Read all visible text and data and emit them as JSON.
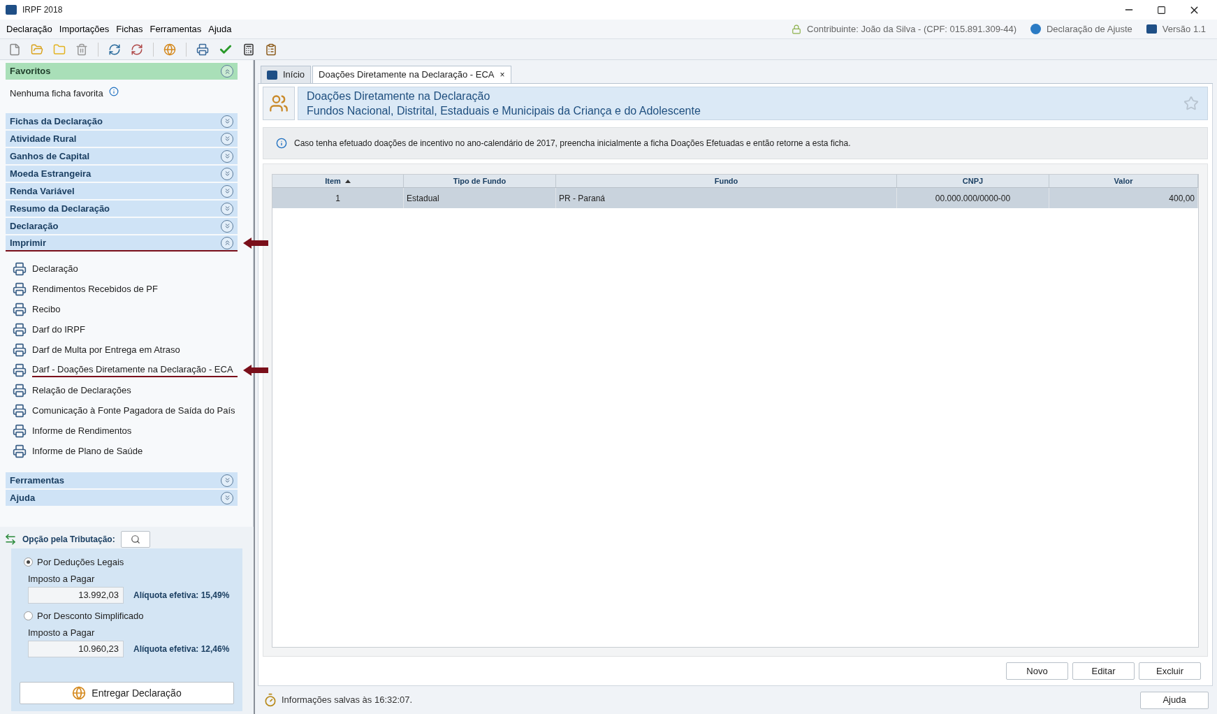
{
  "window": {
    "title": "IRPF 2018"
  },
  "menu": [
    {
      "label": "Declaração"
    },
    {
      "label": "Importações"
    },
    {
      "label": "Fichas"
    },
    {
      "label": "Ferramentas"
    },
    {
      "label": "Ajuda"
    }
  ],
  "header_info": {
    "contributor": "Contribuinte: João da Silva - (CPF: 015.891.309-44)",
    "declaration_type": "Declaração de Ajuste",
    "version": "Versão 1.1"
  },
  "favorites": {
    "title": "Favoritos",
    "expanded": true,
    "empty_text": "Nenhuma ficha favorita"
  },
  "sections": [
    {
      "title": "Fichas da Declaração",
      "expanded": false,
      "highlighted": false
    },
    {
      "title": "Atividade Rural",
      "expanded": false,
      "highlighted": false
    },
    {
      "title": "Ganhos de Capital",
      "expanded": false,
      "highlighted": false
    },
    {
      "title": "Moeda Estrangeira",
      "expanded": false,
      "highlighted": false
    },
    {
      "title": "Renda Variável",
      "expanded": false,
      "highlighted": false
    },
    {
      "title": "Resumo da Declaração",
      "expanded": false,
      "highlighted": false
    },
    {
      "title": "Declaração",
      "expanded": false,
      "highlighted": false
    },
    {
      "title": "Imprimir",
      "expanded": true,
      "highlighted": true,
      "items": [
        {
          "label": "Declaração",
          "highlighted": false
        },
        {
          "label": "Rendimentos Recebidos de PF",
          "highlighted": false
        },
        {
          "label": "Recibo",
          "highlighted": false
        },
        {
          "label": "Darf do IRPF",
          "highlighted": false
        },
        {
          "label": "Darf de Multa por Entrega em Atraso",
          "highlighted": false
        },
        {
          "label": "Darf - Doações Diretamente na Declaração - ECA",
          "highlighted": true
        },
        {
          "label": "Relação de Declarações",
          "highlighted": false
        },
        {
          "label": "Comunicação à Fonte Pagadora de Saída do País",
          "highlighted": false
        },
        {
          "label": "Informe de Rendimentos",
          "highlighted": false
        },
        {
          "label": "Informe de Plano de Saúde",
          "highlighted": false
        }
      ]
    },
    {
      "title": "Ferramentas",
      "expanded": false,
      "highlighted": false
    },
    {
      "title": "Ajuda",
      "expanded": false,
      "highlighted": false
    }
  ],
  "tax_option": {
    "label": "Opção pela Tributação:",
    "options": [
      {
        "label": "Por Deduções Legais",
        "selected": true,
        "amount_label": "Imposto a Pagar",
        "amount": "13.992,03",
        "rate": "Alíquota efetiva: 15,49%"
      },
      {
        "label": "Por Desconto Simplificado",
        "selected": false,
        "amount_label": "Imposto a Pagar",
        "amount": "10.960,23",
        "rate": "Alíquota efetiva: 12,46%"
      }
    ],
    "submit_button": "Entregar Declaração"
  },
  "tabs": [
    {
      "label": "Início",
      "selected": false
    },
    {
      "label": "Doações Diretamente na Declaração - ECA",
      "selected": true,
      "close": "×"
    }
  ],
  "page_header": {
    "title": "Doações Diretamente na Declaração",
    "subtitle": "Fundos Nacional, Distrital, Estaduais e Municipais da Criança e do Adolescente"
  },
  "info_message": "Caso tenha efetuado doações de incentivo no ano-calendário de 2017, preencha inicialmente a ficha Doações Efetuadas e então retorne a esta ficha.",
  "table": {
    "columns": [
      {
        "label": "Item",
        "sorted": true
      },
      {
        "label": "Tipo de Fundo",
        "sorted": false
      },
      {
        "label": "Fundo",
        "sorted": false
      },
      {
        "label": "CNPJ",
        "sorted": false
      },
      {
        "label": "Valor",
        "sorted": false
      }
    ],
    "rows": [
      {
        "selected": true,
        "cells": [
          "1",
          "Estadual",
          "PR - Paraná",
          "00.000.000/0000-00",
          "400,00"
        ]
      }
    ]
  },
  "actions": [
    {
      "label": "Novo"
    },
    {
      "label": "Editar"
    },
    {
      "label": "Excluir"
    }
  ],
  "status": {
    "text": "Informações salvas às 16:32:07.",
    "help_button": "Ajuda"
  }
}
